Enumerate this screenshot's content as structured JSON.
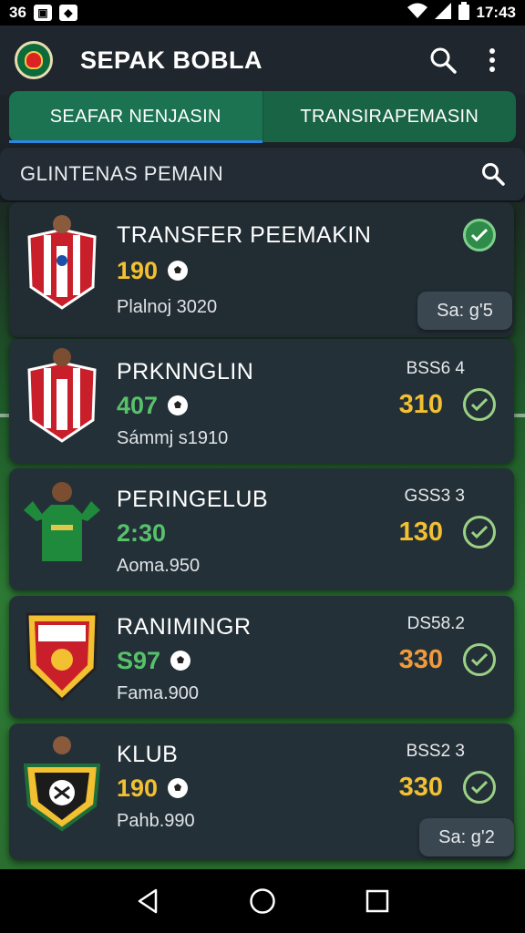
{
  "status": {
    "left_text": "36",
    "time": "17:43"
  },
  "app": {
    "title": "SEPAK BOBLA"
  },
  "tabs": [
    {
      "label": "SEAFAR NENJASIN"
    },
    {
      "label": "TRANSIRAPEMASIN"
    }
  ],
  "search": {
    "text": "GLINTENAS PEMAIN"
  },
  "players": [
    {
      "name": "TRANSFER PEEMAKIN",
      "rating": "190",
      "rating_color": "#f2c030",
      "sub": "Plalnoj 3020",
      "code": "",
      "value": "",
      "value_color": "#f2c030",
      "chip": "Sa: g'5",
      "check_filled": true,
      "jersey": "red-white-stripes"
    },
    {
      "name": "PRKNNGLIN",
      "rating": "407",
      "rating_color": "#57c26a",
      "sub": "Sámmj s1910",
      "code": "BSS6 4",
      "value": "310",
      "value_color": "#f2c030",
      "chip": "",
      "check_filled": false,
      "jersey": "red-white-stripes"
    },
    {
      "name": "PERINGELUB",
      "rating": "2:30",
      "rating_color": "#57c26a",
      "sub": "Aoma.950",
      "code": "GSS3 3",
      "value": "130",
      "value_color": "#f2c030",
      "chip": "",
      "check_filled": false,
      "jersey": "green"
    },
    {
      "name": "RANIMINGR",
      "rating": "S97",
      "rating_color": "#57c26a",
      "sub": "Fama.900",
      "code": "DS58.2",
      "value": "330",
      "value_color": "#f09a3a",
      "chip": "",
      "check_filled": false,
      "jersey": "red-yellow-crest"
    },
    {
      "name": "KLUB",
      "rating": "190",
      "rating_color": "#f2c030",
      "sub": "Pahb.990",
      "code": "BSS2 3",
      "value": "330",
      "value_color": "#f2c030",
      "chip": "Sa: g'2",
      "check_filled": false,
      "jersey": "black-white-crest"
    }
  ],
  "icons": {
    "search": "search-icon",
    "more": "more-vert-icon",
    "check": "check-icon",
    "ball": "soccer-ball-icon"
  }
}
